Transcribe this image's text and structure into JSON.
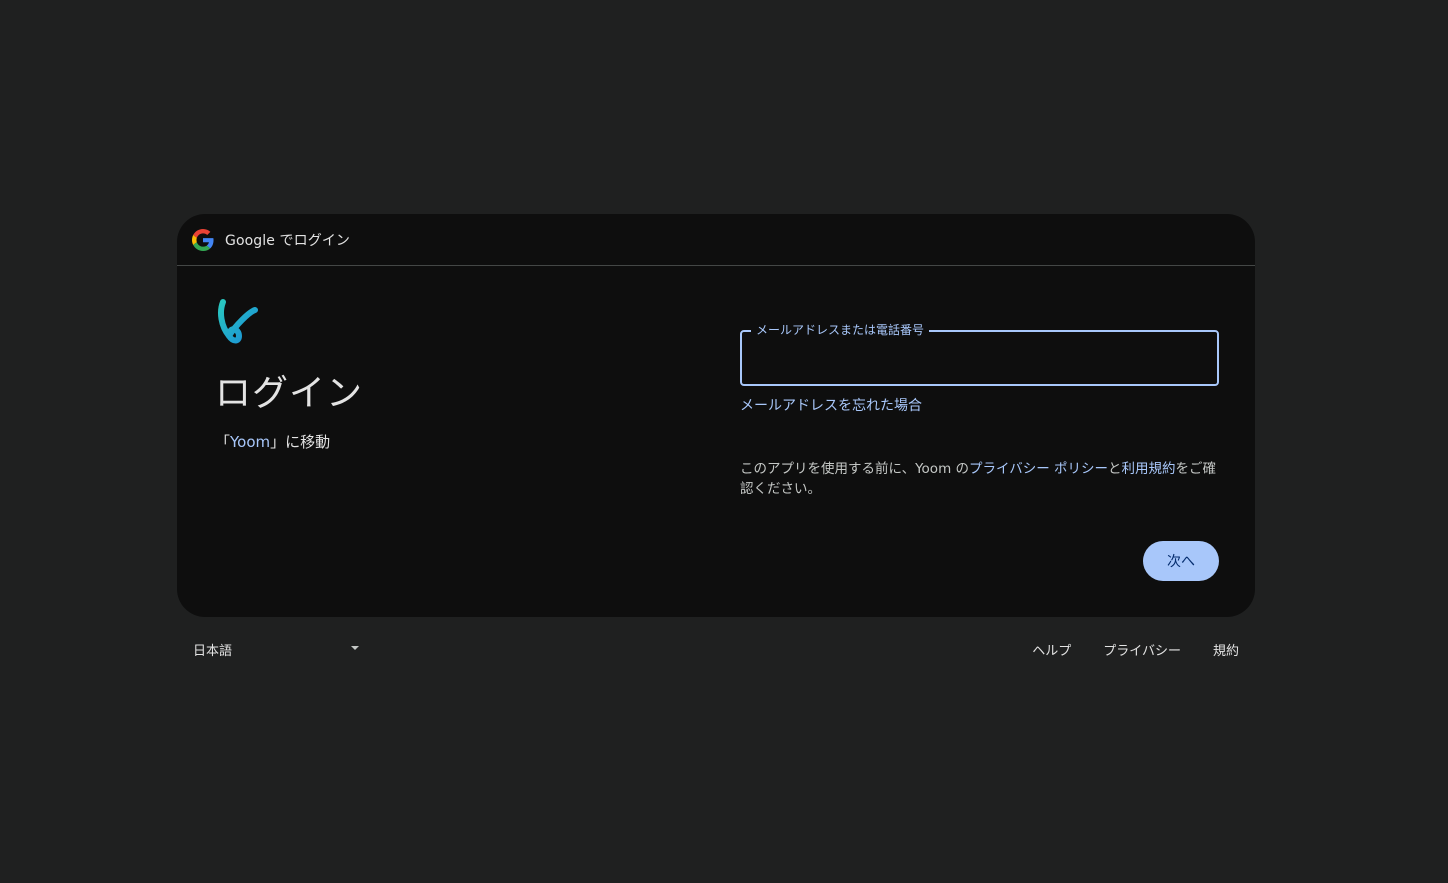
{
  "header": {
    "brand": "Google",
    "title": "Google でログイン",
    "icon": "google-g-icon"
  },
  "app": {
    "logo_icon": "yoom-logo-icon",
    "logo_color": "#1fb6d1"
  },
  "main": {
    "title": "ログイン",
    "subtitle_prefix": "「",
    "app_name": "Yoom",
    "subtitle_suffix": "」に移動"
  },
  "form": {
    "email_label": "メールアドレスまたは電話番号",
    "email_value": "",
    "forgot_email": "メールアドレスを忘れた場合"
  },
  "consent": {
    "prefix": "このアプリを使用する前に、Yoom の",
    "privacy_link": "プライバシー ポリシー",
    "and": "と",
    "terms_link": "利用規約",
    "suffix": "をご確認ください。"
  },
  "actions": {
    "next_label": "次へ"
  },
  "footer": {
    "language": "日本語",
    "help": "ヘルプ",
    "privacy": "プライバシー",
    "terms": "規約"
  },
  "colors": {
    "background": "#1f2020",
    "card": "#0e0e0e",
    "accent": "#a8c7fa"
  }
}
